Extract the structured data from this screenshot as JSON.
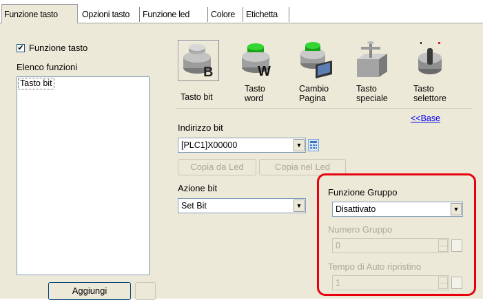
{
  "tabs": [
    {
      "label": "Funzione tasto",
      "active": true
    },
    {
      "label": "Opzioni tasto"
    },
    {
      "label": "Funzione led"
    },
    {
      "label": "Colore"
    },
    {
      "label": "Etichetta"
    }
  ],
  "left": {
    "checkbox_label": "Funzione tasto",
    "checkbox_checked": true,
    "list_title": "Elenco funzioni",
    "list_items": [
      "Tasto bit"
    ],
    "add_button": "Aggiungi"
  },
  "key_types": [
    {
      "label_line1": "Tasto bit",
      "label_line2": "",
      "icon": "bit-switch-icon",
      "selected": true
    },
    {
      "label_line1": "Tasto",
      "label_line2": "word",
      "icon": "word-switch-icon"
    },
    {
      "label_line1": "Cambio",
      "label_line2": "Pagina",
      "icon": "change-screen-icon"
    },
    {
      "label_line1": "Tasto",
      "label_line2": "speciale",
      "icon": "special-switch-icon"
    },
    {
      "label_line1": "Tasto",
      "label_line2": "selettore",
      "icon": "selector-switch-icon"
    }
  ],
  "base_link": "<<Base",
  "bit_address": {
    "label": "Indirizzo bit",
    "value": "[PLC1]X00000",
    "copy_from_led": "Copia da Led",
    "copy_to_led": "Copia nel Led"
  },
  "bit_action": {
    "label": "Azione bit",
    "value": "Set Bit"
  },
  "group": {
    "function_label": "Funzione Gruppo",
    "function_value": "Disattivato",
    "number_label": "Numero Gruppo",
    "number_value": "0",
    "auto_reset_label": "Tempo di Auto ripristino",
    "auto_reset_value": "1",
    "highlight_color": "#e8000f"
  }
}
